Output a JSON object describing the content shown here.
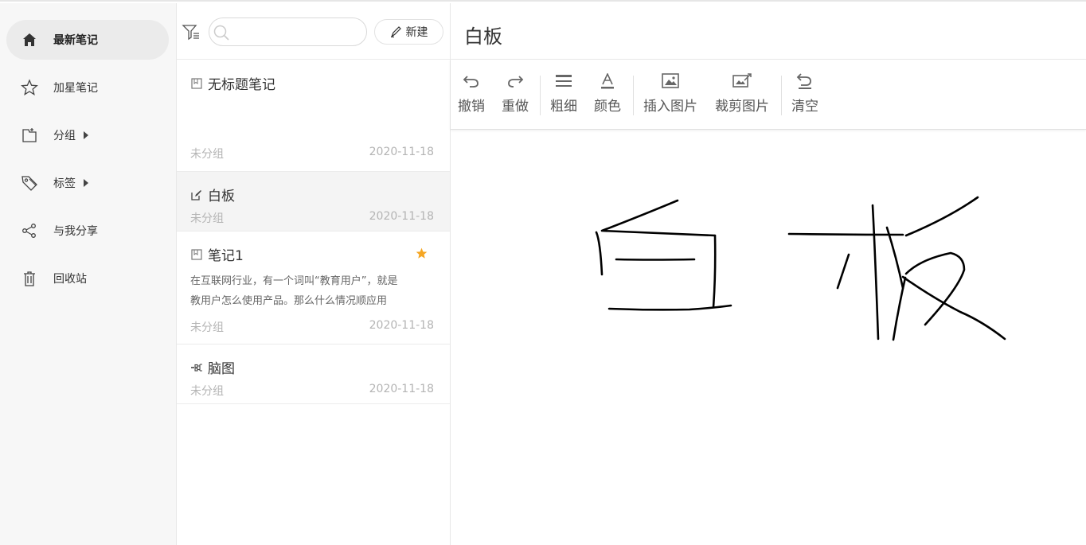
{
  "sidebar": {
    "items": [
      {
        "label": "最新笔记",
        "icon": "home-icon"
      },
      {
        "label": "加星笔记",
        "icon": "star-outline-icon"
      },
      {
        "label": "分组",
        "icon": "folder-icon"
      },
      {
        "label": "标签",
        "icon": "tag-icon"
      },
      {
        "label": "与我分享",
        "icon": "share-icon"
      },
      {
        "label": "回收站",
        "icon": "trash-icon"
      }
    ]
  },
  "list": {
    "search_placeholder": "",
    "new_button_label": "新建",
    "notes": [
      {
        "title": "无标题笔记",
        "group": "未分组",
        "date": "2020-11-18",
        "icon": "note-icon"
      },
      {
        "title": "白板",
        "group": "未分组",
        "date": "2020-11-18",
        "icon": "whiteboard-icon"
      },
      {
        "title": "笔记1",
        "group": "未分组",
        "date": "2020-11-18",
        "icon": "note-icon",
        "starred": true,
        "excerpt_line1": "在互联网行业，有一个词叫“教育用户”，就是",
        "excerpt_line2": "教用户怎么使用产品。那么什么情况顺应用"
      },
      {
        "title": "脑图",
        "group": "未分组",
        "date": "2020-11-18",
        "icon": "mindmap-icon"
      }
    ]
  },
  "editor": {
    "title": "白板",
    "toolbar": {
      "undo": "撤销",
      "redo": "重做",
      "thickness": "粗细",
      "color": "颜色",
      "insert_image": "插入图片",
      "crop_image": "裁剪图片",
      "clear": "清空"
    },
    "drawing_text": "白 板"
  },
  "colors": {
    "accent_star": "#f5a623",
    "sidebar_bg": "#f7f7f7",
    "active_item_bg": "#ebebeb",
    "selected_card_bg": "#f4f4f4"
  }
}
